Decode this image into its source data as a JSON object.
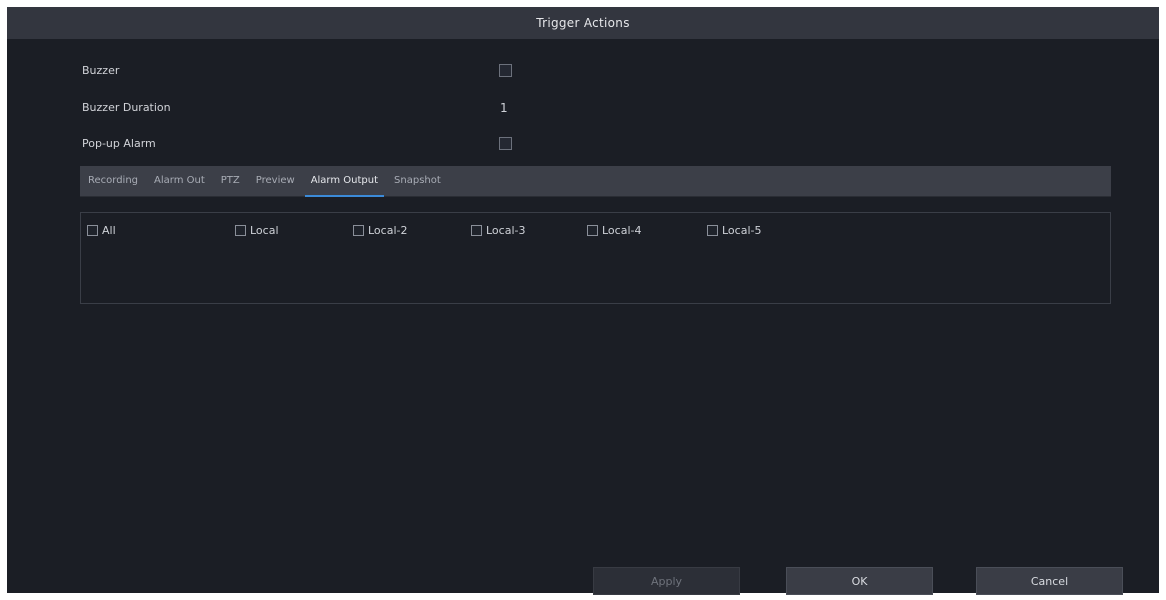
{
  "window": {
    "title": "Trigger Actions"
  },
  "fields": [
    {
      "label": "Buzzer",
      "value": "☐",
      "kind": "checkbox"
    },
    {
      "label": "Buzzer Duration",
      "value": "1",
      "kind": "value"
    },
    {
      "label": "Pop-up Alarm",
      "value": "",
      "kind": "checkbox"
    }
  ],
  "tabs": [
    {
      "label": "Recording"
    },
    {
      "label": "Alarm Out"
    },
    {
      "label": "PTZ"
    },
    {
      "label": "Preview"
    },
    {
      "label": "Alarm Output",
      "active": true
    },
    {
      "label": "Snapshot"
    }
  ],
  "options": [
    {
      "label": "All"
    },
    {
      "label": "Local"
    },
    {
      "label": "Local-2"
    },
    {
      "label": "Local-3"
    },
    {
      "label": "Local-4"
    },
    {
      "label": "Local-5"
    }
  ],
  "buttons": {
    "apply": "Apply",
    "ok": "OK",
    "cancel": "Cancel"
  }
}
